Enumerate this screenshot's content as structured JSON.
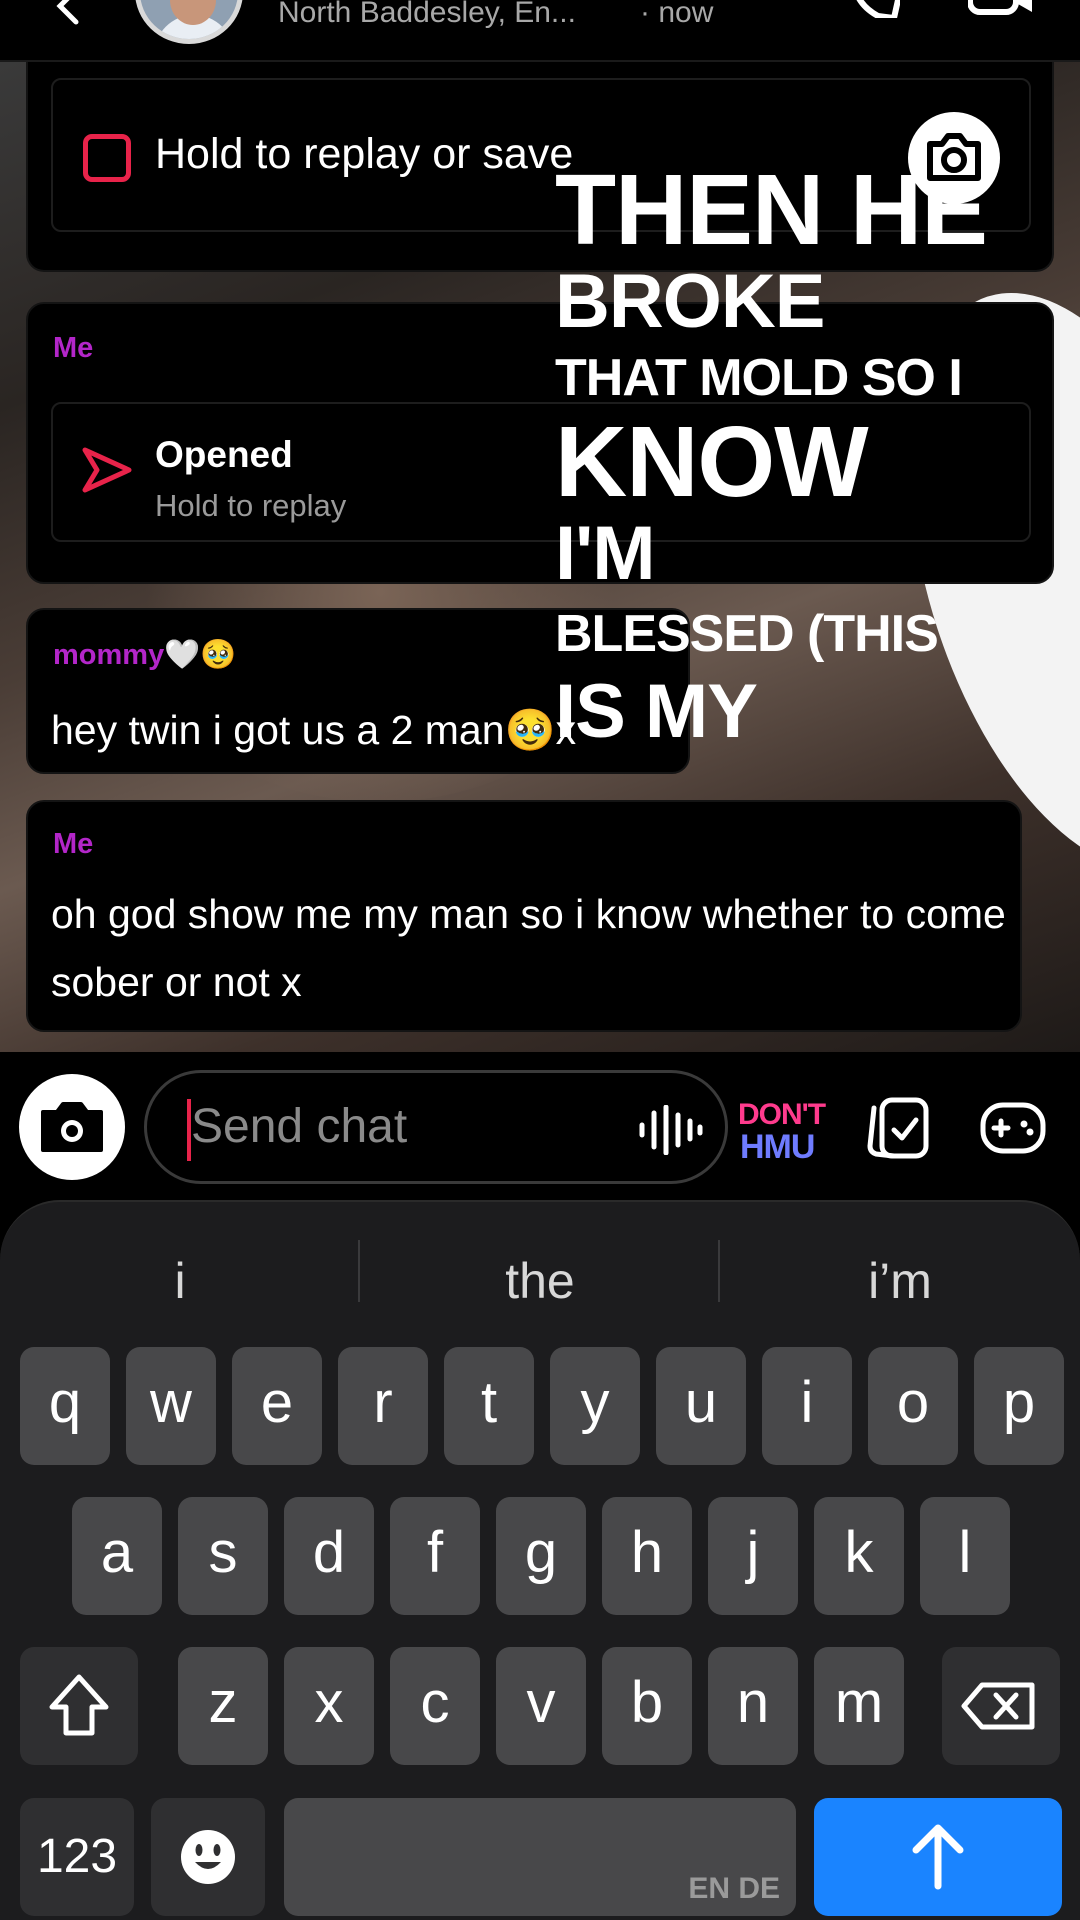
{
  "header": {
    "location": "North Baddesley, En...",
    "timestamp": "· now"
  },
  "messages": [
    {
      "type": "snap",
      "label": "Hold to replay or save"
    },
    {
      "type": "snap",
      "sender": "Me",
      "status": "Opened",
      "sub": "Hold to replay"
    },
    {
      "type": "text",
      "sender": "mommy🤍🥹",
      "text": "hey twin i got us a 2 man🥹x"
    },
    {
      "type": "text",
      "sender": "Me",
      "text": "oh god show me my man so i know whether to come sober or not x"
    }
  ],
  "caption_lines": [
    "THEN HE",
    "BROKE",
    "THAT MOLD SO I",
    "KNOW",
    "I'M",
    "BLESSED (THIS",
    "IS MY"
  ],
  "input": {
    "placeholder": "Send chat",
    "sticker_top": "DON'T",
    "sticker_bottom": "HMU"
  },
  "keyboard": {
    "suggestions": [
      "i",
      "the",
      "i’m"
    ],
    "row1": [
      "q",
      "w",
      "e",
      "r",
      "t",
      "y",
      "u",
      "i",
      "o",
      "p"
    ],
    "row2": [
      "a",
      "s",
      "d",
      "f",
      "g",
      "h",
      "j",
      "k",
      "l"
    ],
    "row3": [
      "z",
      "x",
      "c",
      "v",
      "b",
      "n",
      "m"
    ],
    "num_label": "123",
    "lang_label": "EN DE"
  },
  "colors": {
    "accent_red": "#e8234a",
    "sender_purple": "#b326c9",
    "send_blue": "#1a84ff"
  },
  "icons": [
    "back-chevron-icon",
    "phone-icon",
    "video-icon",
    "camera-icon",
    "voice-icon",
    "memories-icon",
    "games-icon",
    "shift-icon",
    "delete-icon",
    "emoji-icon",
    "send-arrow-icon",
    "opened-arrow-icon"
  ]
}
